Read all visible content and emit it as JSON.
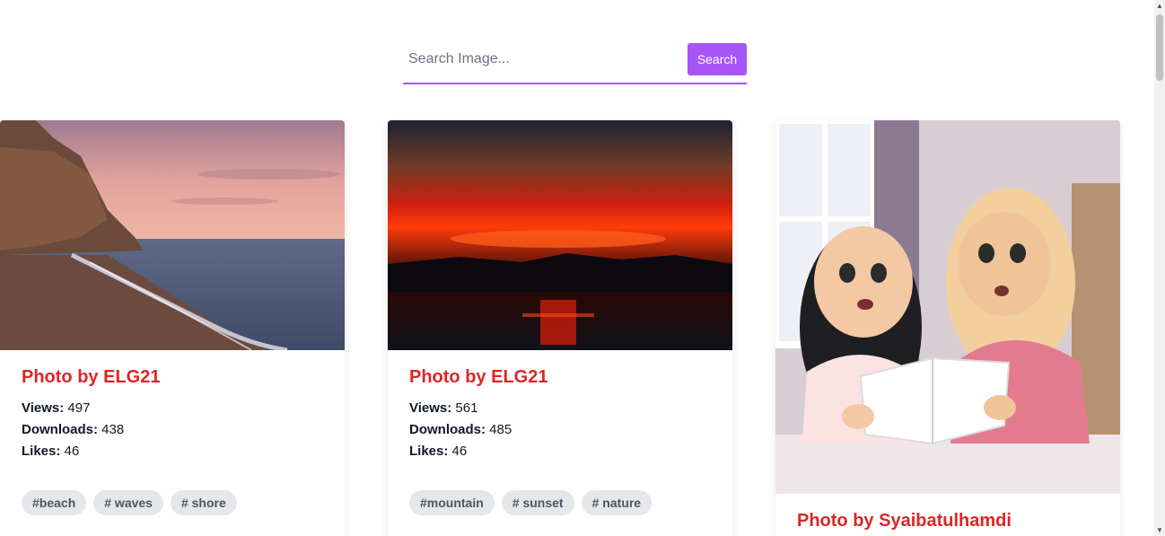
{
  "search": {
    "placeholder": "Search Image...",
    "button_label": "Search"
  },
  "colors": {
    "accent": "#a855f7",
    "title": "#dc2626",
    "tag_bg": "#e5e7eb"
  },
  "cards": [
    {
      "title": "Photo by ELG21",
      "views_label": "Views:",
      "views": "497",
      "downloads_label": "Downloads:",
      "downloads": "438",
      "likes_label": "Likes:",
      "likes": "46",
      "tags": [
        "#beach",
        "# waves",
        "# shore"
      ]
    },
    {
      "title": "Photo by ELG21",
      "views_label": "Views:",
      "views": "561",
      "downloads_label": "Downloads:",
      "downloads": "485",
      "likes_label": "Likes:",
      "likes": "46",
      "tags": [
        "#mountain",
        "# sunset",
        "# nature"
      ]
    },
    {
      "title": "Photo by Syaibatulhamdi"
    }
  ],
  "scrollbar": {
    "up_icon": "arrow-up-icon",
    "down_icon": "arrow-down-icon"
  }
}
